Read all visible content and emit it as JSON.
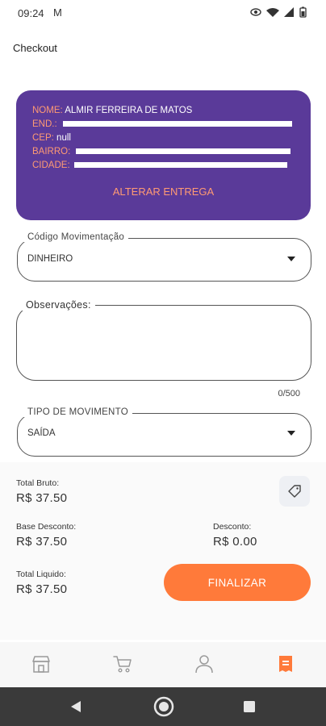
{
  "status_bar": {
    "time": "09:24",
    "mail_glyph": "M"
  },
  "app_bar": {
    "title": "Checkout"
  },
  "delivery_card": {
    "name_label": "NOME:",
    "name_value": "ALMIR FERREIRA DE MATOS",
    "address_label": "END.:",
    "cep_label": "CEP:",
    "cep_value": "null",
    "district_label": "BAIRRO:",
    "city_label": "CIDADE:",
    "change_label": "ALTERAR ENTREGA"
  },
  "movement_code": {
    "label": "Código Movimentação",
    "value": "DINHEIRO"
  },
  "observations": {
    "label": "Observações:",
    "value": "",
    "counter": "0/500"
  },
  "movement_type": {
    "label": "TIPO DE MOVIMENTO",
    "value": "SAÍDA"
  },
  "summary": {
    "gross_label": "Total Bruto:",
    "gross_value": "R$ 37.50",
    "discount_base_label": "Base Desconto:",
    "discount_base_value": "R$ 37.50",
    "discount_label": "Desconto:",
    "discount_value": "R$ 0.00",
    "net_label": "Total Liquido:",
    "net_value": "R$ 37.50",
    "finalize_label": "FINALIZAR"
  },
  "bottom_nav": {
    "items": [
      {
        "icon": "store-icon",
        "active": false
      },
      {
        "icon": "cart-icon",
        "active": false
      },
      {
        "icon": "user-icon",
        "active": false
      },
      {
        "icon": "receipt-icon",
        "active": true
      }
    ]
  },
  "colors": {
    "card": "#5a3a99",
    "accent": "#ff7a3a",
    "label_orange": "#ff9a73"
  }
}
